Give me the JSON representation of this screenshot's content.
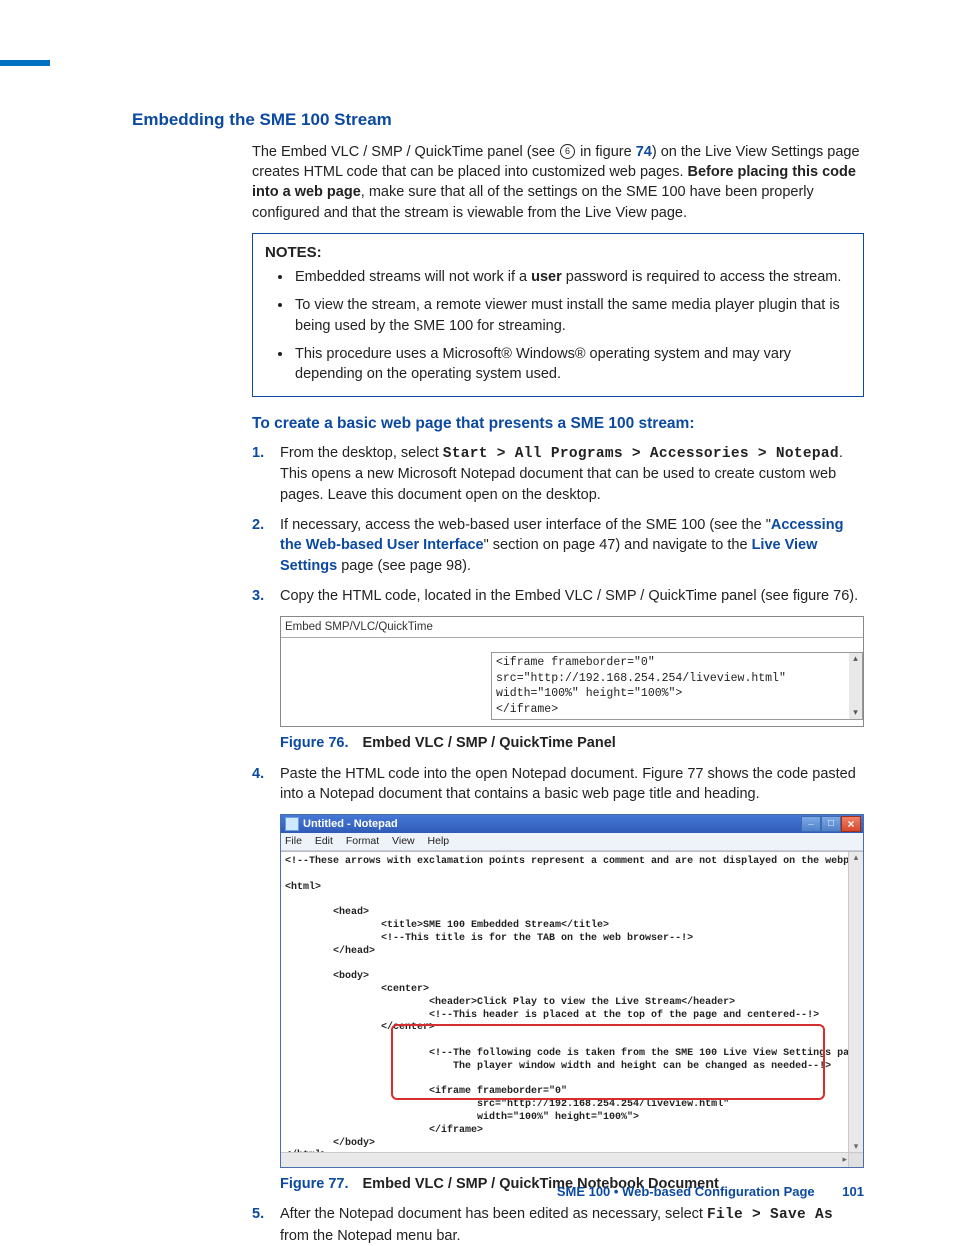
{
  "heading": "Embedding the SME 100 Stream",
  "intro": {
    "pre": "The Embed VLC / SMP / QuickTime panel (see ",
    "circled": "6",
    "mid": " in figure ",
    "figref": "74",
    "post1": ") on the Live View Settings page creates HTML code that can be placed into customized web pages. ",
    "bold": "Before placing this code into a web page",
    "post2": ", make sure that all of the settings on the SME 100 have been properly configured and that the stream is viewable from the Live View page."
  },
  "notes": {
    "title": "NOTES:",
    "items": [
      {
        "pre": "Embedded streams will not work if a ",
        "b": "user",
        "post": " password is required to access the stream."
      },
      {
        "text": "To view the stream, a remote viewer must install the same media player plugin that is being used by the SME 100 for streaming."
      },
      {
        "text": "This procedure uses a Microsoft® Windows® operating system and may vary depending on the operating system used."
      }
    ]
  },
  "subheading": "To create a basic web page that presents a SME 100 stream:",
  "steps": {
    "s1": {
      "pre": "From the desktop, select ",
      "mono": "Start > All Programs > Accessories > Notepad",
      "post": ". This opens a new Microsoft Notepad document that can be used to create custom web pages. Leave this document open on the desktop."
    },
    "s2": {
      "part1": "If necessary, access the web-based user interface of the SME 100 (see the \"",
      "link1": "Accessing the Web-based User Interface",
      "part2": "\" section on page 47) and navigate to the ",
      "link2": "Live View Settings",
      "part3": " page (see page 98)."
    },
    "s3": "Copy the HTML code, located in the Embed VLC / SMP / QuickTime panel (see figure 76).",
    "s4": "Paste the HTML code into the open Notepad document. Figure 77 shows the code pasted into a Notepad document that contains a basic web page title and heading.",
    "s5": {
      "pre": "After the Notepad document has been edited as necessary, select ",
      "mono": "File > Save As",
      "post": " from the Notepad menu bar."
    }
  },
  "panel76": {
    "title": "Embed SMP/VLC/QuickTime",
    "code": "<iframe frameborder=\"0\"\nsrc=\"http://192.168.254.254/liveview.html\"\nwidth=\"100%\" height=\"100%\">\n</iframe>"
  },
  "fig76": {
    "num": "Figure 76.",
    "caption": "Embed VLC / SMP / QuickTime Panel"
  },
  "notepad": {
    "title": "Untitled - Notepad",
    "menu": [
      "File",
      "Edit",
      "Format",
      "View",
      "Help"
    ],
    "code": "<!--These arrows with exclamation points represent a comment and are not displayed on the webpage--!>\n\n<html>\n\n        <head>\n                <title>SME 100 Embedded Stream</title>\n                <!--This title is for the TAB on the web browser--!>\n        </head>\n\n        <body>\n                <center>\n                        <header>Click Play to view the Live Stream</header>\n                        <!--This header is placed at the top of the page and centered--!>\n                </center>\n\n                        <!--The following code is taken from the SME 100 Live View Settings page\n                            The player window width and height can be changed as needed--!>\n\n                        <iframe frameborder=\"0\"\n                                src=\"http://192.168.254.254/liveview.html\"\n                                width=\"100%\" height=\"100%\">\n                        </iframe>\n        </body>\n</html>"
  },
  "fig77": {
    "num": "Figure 77.",
    "caption": "Embed VLC / SMP / QuickTime Notebook Document"
  },
  "footer": {
    "text": "SME 100 • Web-based Configuration Page",
    "page": "101"
  }
}
